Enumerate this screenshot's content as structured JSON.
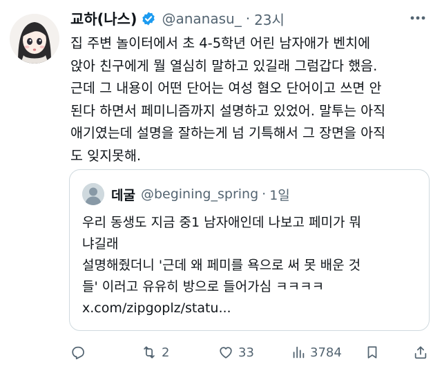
{
  "tweet": {
    "display_name": "교하(나스)",
    "handle": "@ananasu_",
    "separator": "·",
    "time": "23시",
    "text": "집 주변 놀이터에서 초 4-5학년 어린 남자애가 벤치에\n앉아 친구에게 뭘 열심히 말하고 있길래  그럼갑다 했음.\n근데 그 내용이 어떤 단어는 여성 혐오 단어이고 쓰면 안\n된다 하면서 페미니즘까지 설명하고 있었어. 말투는 아직\n애기였는데 설명을 잘하는게 넘 기특해서 그 장면을 아직\n도 잊지못해."
  },
  "quote": {
    "display_name": "데굴",
    "handle": "@begining_spring",
    "separator": "·",
    "time": "1일",
    "text": "우리 동생도 지금 중1 남자애인데 나보고 페미가 뭐\n냐길래\n설명해줬더니 '근데 왜 페미를 욕으로 써 못 배운 것\n들' 이러고 유유히 방으로 들어가심 ㅋㅋㅋㅋ\nx.com/zipgoplz/statu..."
  },
  "actions": {
    "reply_icon": "reply-icon",
    "retweet_icon": "retweet-icon",
    "retweet_count": "2",
    "like_icon": "heart-icon",
    "like_count": "33",
    "views_icon": "views-chart-icon",
    "views_count": "3784",
    "bookmark_icon": "bookmark-icon",
    "share_icon": "share-icon"
  },
  "colors": {
    "text_primary": "#0f1419",
    "text_secondary": "#536471",
    "verified_blue": "#1d9bf0",
    "border": "#cfd9de",
    "background": "#ffffff"
  }
}
